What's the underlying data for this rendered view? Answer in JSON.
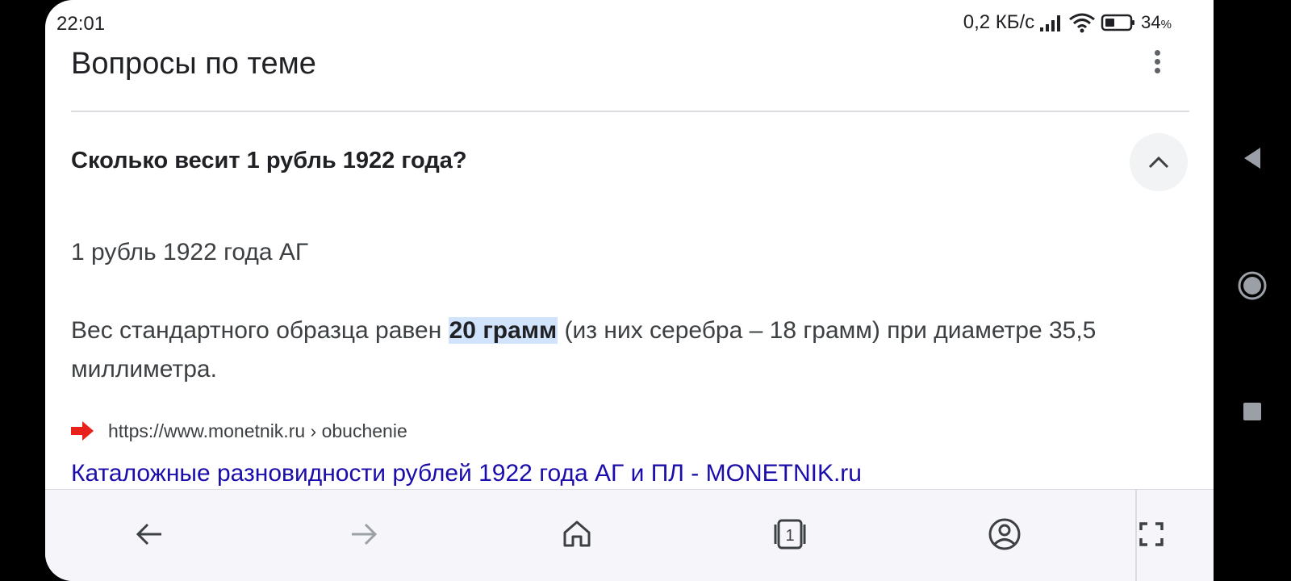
{
  "status_bar": {
    "time": "22:01",
    "net_speed": "0,2 КБ/с",
    "battery": "34",
    "battery_unit": "%"
  },
  "section": {
    "title": "Вопросы по теме"
  },
  "question": {
    "text": "Сколько весит 1 рубль 1922 года?"
  },
  "answer": {
    "title": "1 рубль 1922 года АГ",
    "text_before": "Вес стандартного образца равен ",
    "highlight": "20 грамм",
    "text_after": " (из них серебра – 18 грамм) при диаметре 35,5 миллиметра."
  },
  "source": {
    "url": "https://www.monetnik.ru › obuchenie",
    "link_title": "Каталожные разновидности рублей 1922 года АГ и ПЛ - MONETNIK.ru",
    "favicon_color": "#e8221b"
  },
  "toolbar": {
    "tab_count": "1"
  },
  "colors": {
    "link": "#1a0dab",
    "highlight": "#d2e3fc",
    "toolbar_bg": "#f6f6fa"
  }
}
